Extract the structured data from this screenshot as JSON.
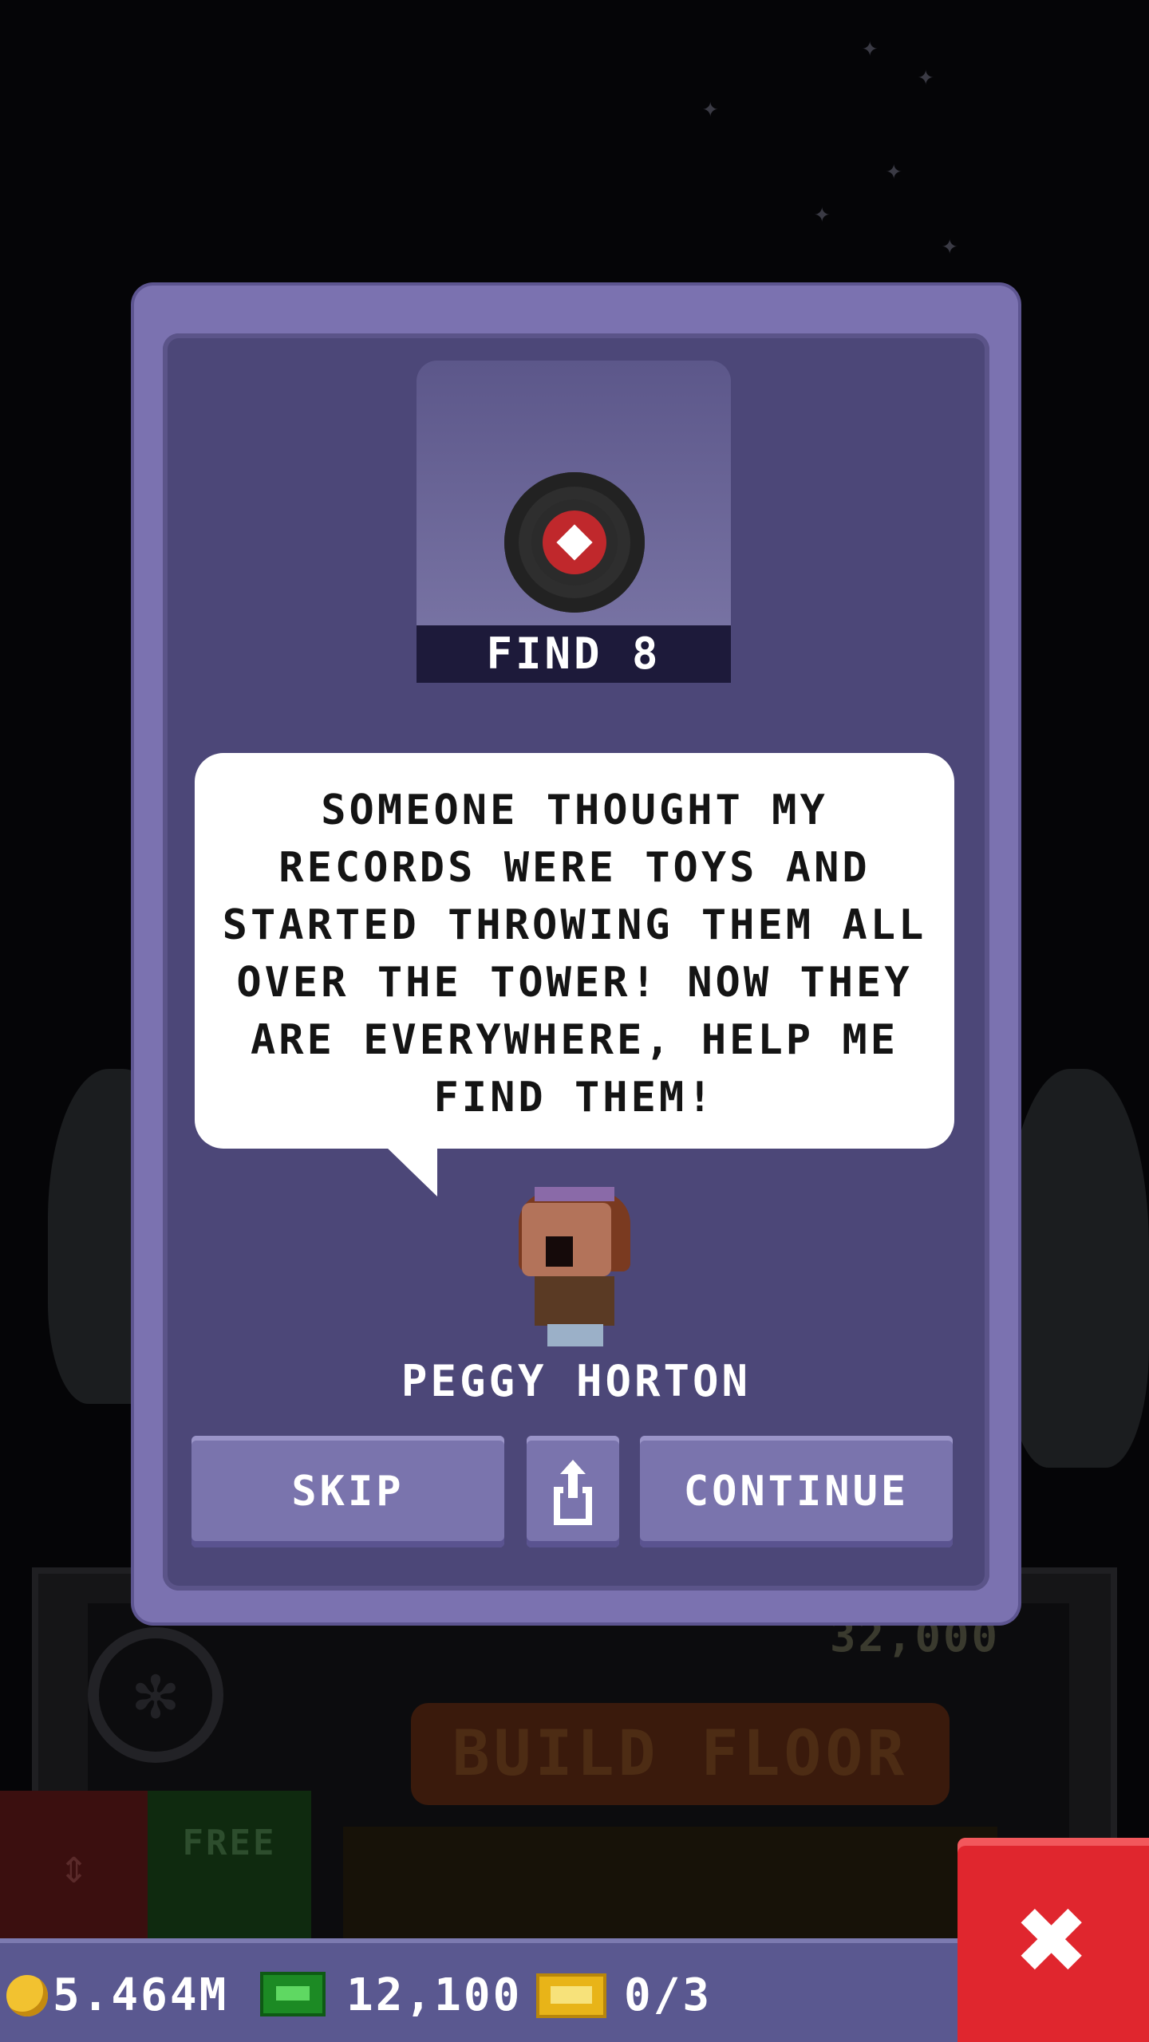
{
  "dialog": {
    "mission_label": "FIND 8",
    "speech_text": "SOMEONE THOUGHT MY RECORDS WERE TOYS AND STARTED THROWING THEM ALL OVER THE TOWER! NOW THEY ARE EVERYWHERE, HELP ME FIND THEM!",
    "character_name": "PEGGY HORTON",
    "buttons": {
      "skip_label": "SKIP",
      "share_icon": "share-icon",
      "continue_label": "CONTINUE"
    }
  },
  "background": {
    "price_label": "32,000",
    "build_floor_label": "BUILD FLOOR",
    "free_label": "FREE"
  },
  "status_bar": {
    "coins": "5.464M",
    "bux": "12,100",
    "tickets": "0/3"
  },
  "close_button": {
    "icon": "close-icon",
    "glyph": "✖"
  },
  "colors": {
    "dialog_outer": "#7b72b0",
    "dialog_inner": "#4c4778",
    "close_red": "#e0262e",
    "status_bar": "#5a5890"
  }
}
